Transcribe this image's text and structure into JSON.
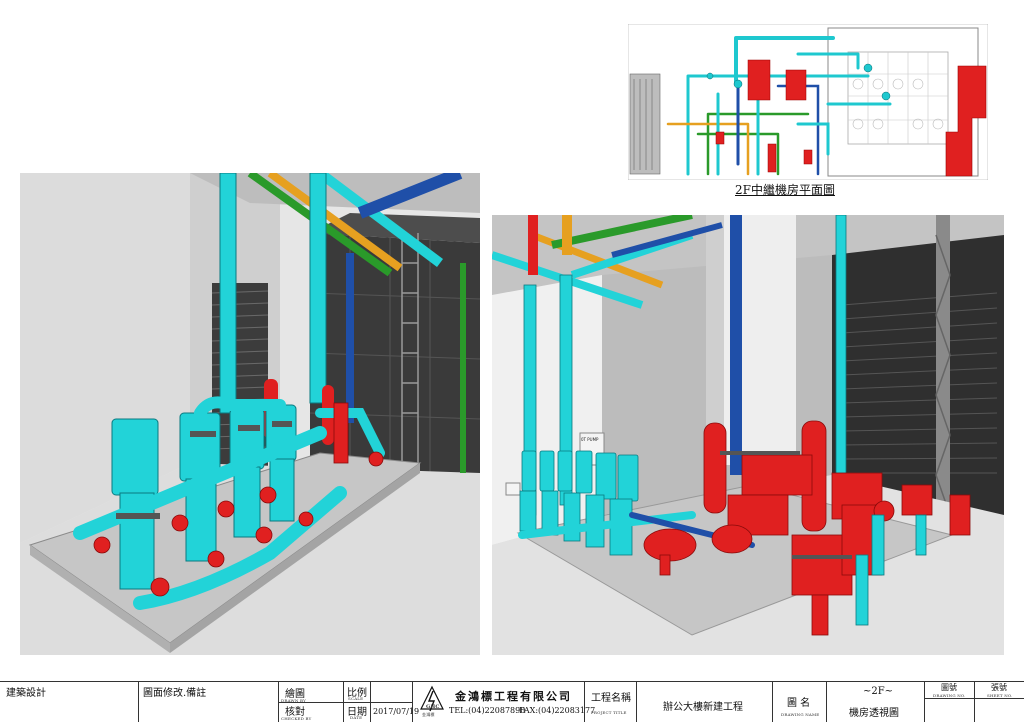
{
  "plan": {
    "caption": "2F中繼機房平面圖"
  },
  "views": {
    "left": {
      "description_name": "pump-room-view-left"
    },
    "right": {
      "description_name": "pump-room-view-right"
    }
  },
  "equipment_labels": {
    "pump_label": "0T PUMP"
  },
  "title_block": {
    "discipline": "建築設計",
    "revision_note": "圖面修改.備註",
    "drawn_by_label": "繪圖",
    "drawn_by_en": "DRAWN BY",
    "checked_by_label": "核對",
    "checked_by_en": "CHECKED BY",
    "scale_label": "比例",
    "scale_en": "SCALE",
    "date_label": "日期",
    "date_en": "DATE",
    "date_value": "2017/07/19",
    "company_logo_text": "GHC",
    "company_logo_sub": "金鴻標",
    "company_name": "金鴻標工程有限公司",
    "tel": "TEL:(04)22087890",
    "fax": "FAX:(04)22083177",
    "project_title_label": "工程名稱",
    "project_title_en": "PROJECT TITLE",
    "project_title_value": "辦公大樓新建工程",
    "drawing_name_label": "圖 名",
    "drawing_name_en": "DRAWING NAME",
    "drawing_floor": "~2F~",
    "drawing_name_value": "機房透視圖",
    "drawing_no_label": "圖號",
    "drawing_no_en": "DRAWING NO.",
    "sheet_no_label": "張號",
    "sheet_no_en": "SHEET NO."
  }
}
